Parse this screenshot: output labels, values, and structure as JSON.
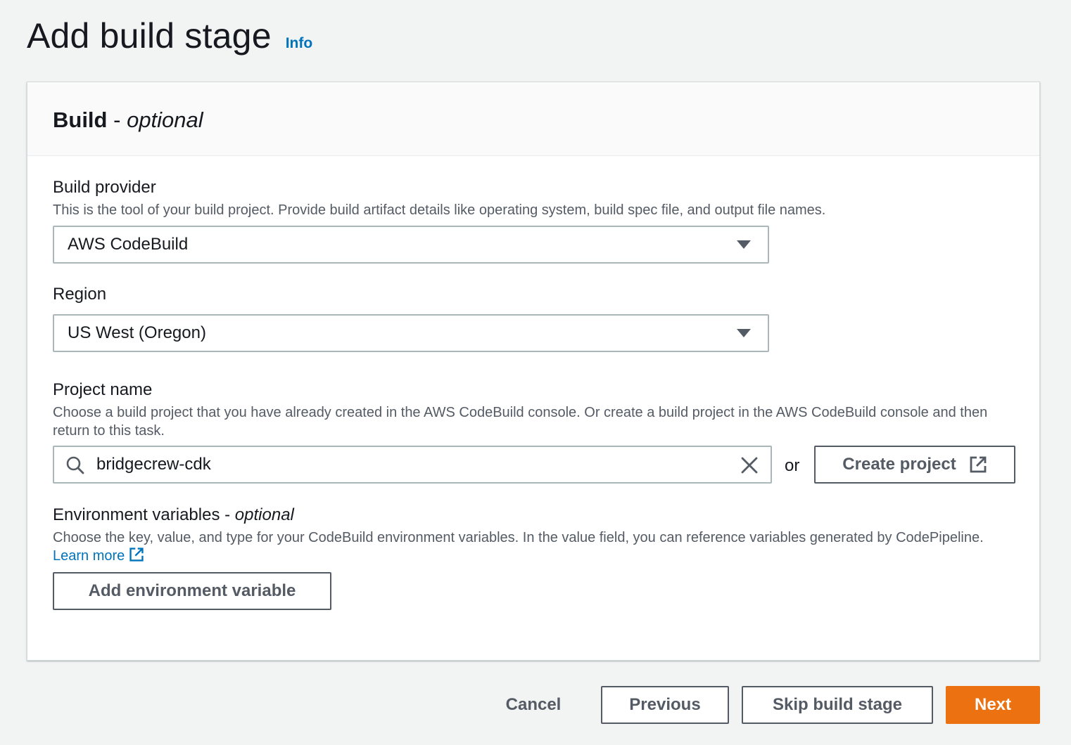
{
  "header": {
    "title": "Add build stage",
    "info_link": "Info"
  },
  "panel": {
    "title": "Build",
    "title_separator": "-",
    "title_optional": "optional"
  },
  "build_provider": {
    "label": "Build provider",
    "description": "This is the tool of your build project. Provide build artifact details like operating system, build spec file, and output file names.",
    "selected": "AWS CodeBuild"
  },
  "region": {
    "label": "Region",
    "selected": "US West (Oregon)"
  },
  "project_name": {
    "label": "Project name",
    "description": "Choose a build project that you have already created in the AWS CodeBuild console. Or create a build project in the AWS CodeBuild console and then return to this task.",
    "value": "bridgecrew-cdk",
    "or_text": "or",
    "create_button": "Create project"
  },
  "env_vars": {
    "label": "Environment variables",
    "label_separator": "-",
    "label_optional": "optional",
    "description": "Choose the key, value, and type for your CodeBuild environment variables. In the value field, you can reference variables generated by CodePipeline.",
    "learn_more": "Learn more",
    "add_button": "Add environment variable"
  },
  "footer": {
    "cancel": "Cancel",
    "previous": "Previous",
    "skip": "Skip build stage",
    "next": "Next"
  },
  "colors": {
    "primary": "#ec7211",
    "link": "#0073bb",
    "background": "#f2f3f3"
  }
}
